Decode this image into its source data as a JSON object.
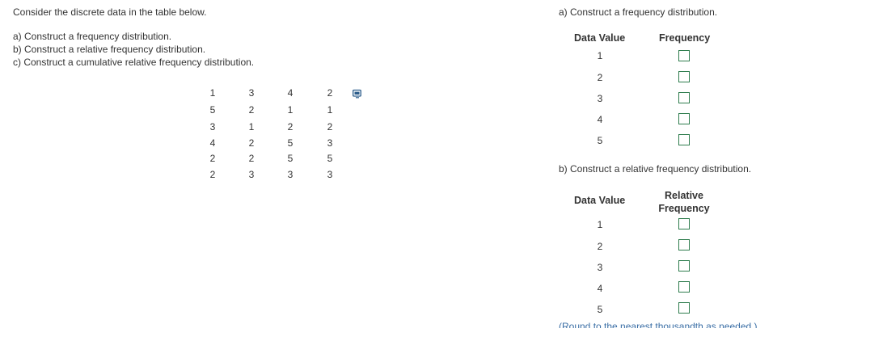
{
  "left": {
    "intro": "Consider the discrete data in the table below.",
    "tasks": [
      "a) Construct a frequency distribution.",
      "b) Construct a relative frequency distribution.",
      "c) Construct a cumulative relative frequency distribution."
    ],
    "data_table": [
      [
        "1",
        "3",
        "4",
        "2"
      ],
      [
        "5",
        "2",
        "1",
        "1"
      ],
      [
        "3",
        "1",
        "2",
        "2"
      ],
      [
        "4",
        "2",
        "5",
        "3"
      ],
      [
        "2",
        "2",
        "5",
        "5"
      ],
      [
        "2",
        "3",
        "3",
        "3"
      ]
    ],
    "copy_icon": "copy-to-clipboard-icon"
  },
  "part_a": {
    "heading": "a) Construct a frequency distribution.",
    "col_data_value": "Data Value",
    "col_frequency": "Frequency",
    "values": [
      "1",
      "2",
      "3",
      "4",
      "5"
    ],
    "answers": [
      "",
      "",
      "",
      "",
      ""
    ]
  },
  "part_b": {
    "heading": "b) Construct a relative frequency distribution.",
    "col_data_value": "Data Value",
    "col_relative_line1": "Relative",
    "col_relative_line2": "Frequency",
    "values": [
      "1",
      "2",
      "3",
      "4",
      "5"
    ],
    "answers": [
      "",
      "",
      "",
      "",
      ""
    ],
    "note": "(Round to the nearest thousandth as needed.)"
  },
  "colors": {
    "answer_box_border": "#2f7d4e",
    "note_text": "#3a6ea5"
  }
}
